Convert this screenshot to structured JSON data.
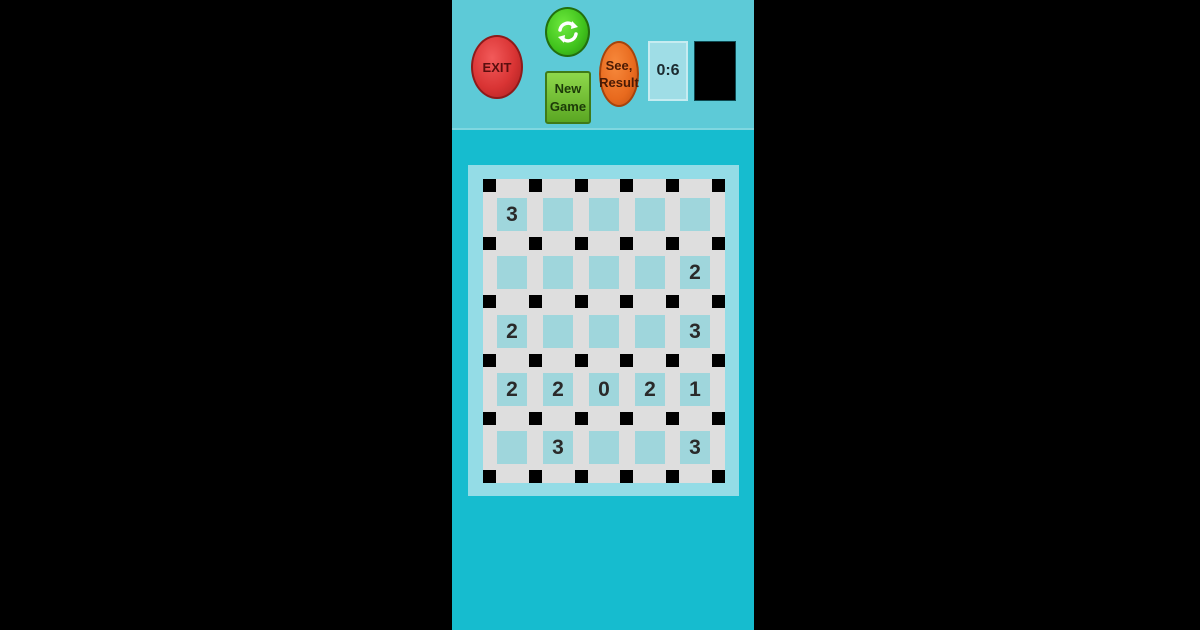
{
  "toolbar": {
    "exit_label": "EXIT",
    "new_game_line1": "New",
    "new_game_line2": "Game",
    "see_result_line1": "See,",
    "see_result_line2": "Result",
    "score": "0:6",
    "refresh_icon": "refresh-icon"
  },
  "colors": {
    "panel_bg": "#16BCCF",
    "topbar_bg": "#5DCAD7",
    "cell_bg": "#9FD6DC",
    "board_bg": "#DEDEDE"
  },
  "board": {
    "rows": 5,
    "cols": 5,
    "cells": [
      [
        "3",
        "",
        "",
        "",
        ""
      ],
      [
        "",
        "",
        "",
        "",
        "2"
      ],
      [
        "2",
        "",
        "",
        "",
        "3"
      ],
      [
        "2",
        "2",
        "0",
        "2",
        "1"
      ],
      [
        "",
        "3",
        "",
        "",
        "3"
      ]
    ]
  }
}
